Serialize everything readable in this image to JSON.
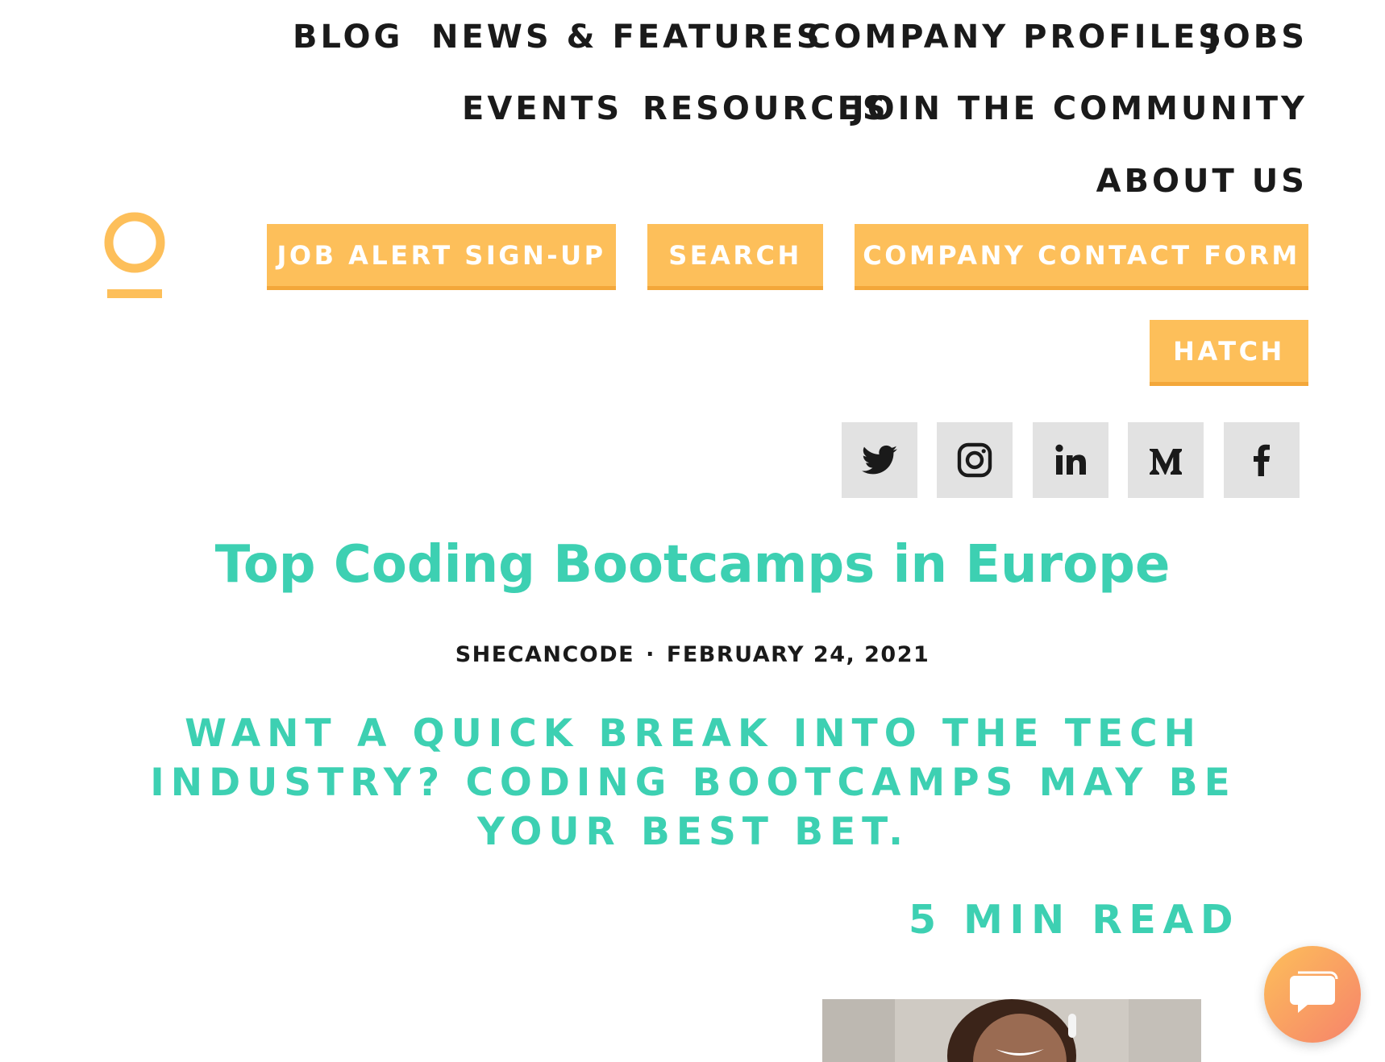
{
  "nav": {
    "items": [
      {
        "label": "BLOG"
      },
      {
        "label": "NEWS & FEATURES"
      },
      {
        "label": "COMPANY PROFILES"
      },
      {
        "label": "JOBS"
      },
      {
        "label": "EVENTS"
      },
      {
        "label": "RESOURCES"
      },
      {
        "label": "JOIN THE COMMUNITY"
      },
      {
        "label": "ABOUT US"
      }
    ]
  },
  "buttons": {
    "job_alert": "JOB ALERT SIGN-UP",
    "search": "SEARCH",
    "company_contact": "COMPANY CONTACT FORM",
    "hatch": "HATCH"
  },
  "social": {
    "icons": [
      "twitter-icon",
      "instagram-icon",
      "linkedin-icon",
      "medium-icon",
      "facebook-icon"
    ]
  },
  "article": {
    "title": "Top Coding Bootcamps in Europe",
    "author": "SHECANCODE",
    "separator": "·",
    "date": "FEBRUARY 24, 2021",
    "subtitle": "WANT A QUICK BREAK INTO THE TECH INDUSTRY? CODING BOOTCAMPS MAY BE YOUR BEST BET.",
    "read_time": "5 MIN READ"
  },
  "colors": {
    "accent_teal": "#3dd0b2",
    "accent_yellow": "#fdbf5a",
    "social_bg": "#e2e2e2",
    "text_dark": "#1a1a1a"
  }
}
